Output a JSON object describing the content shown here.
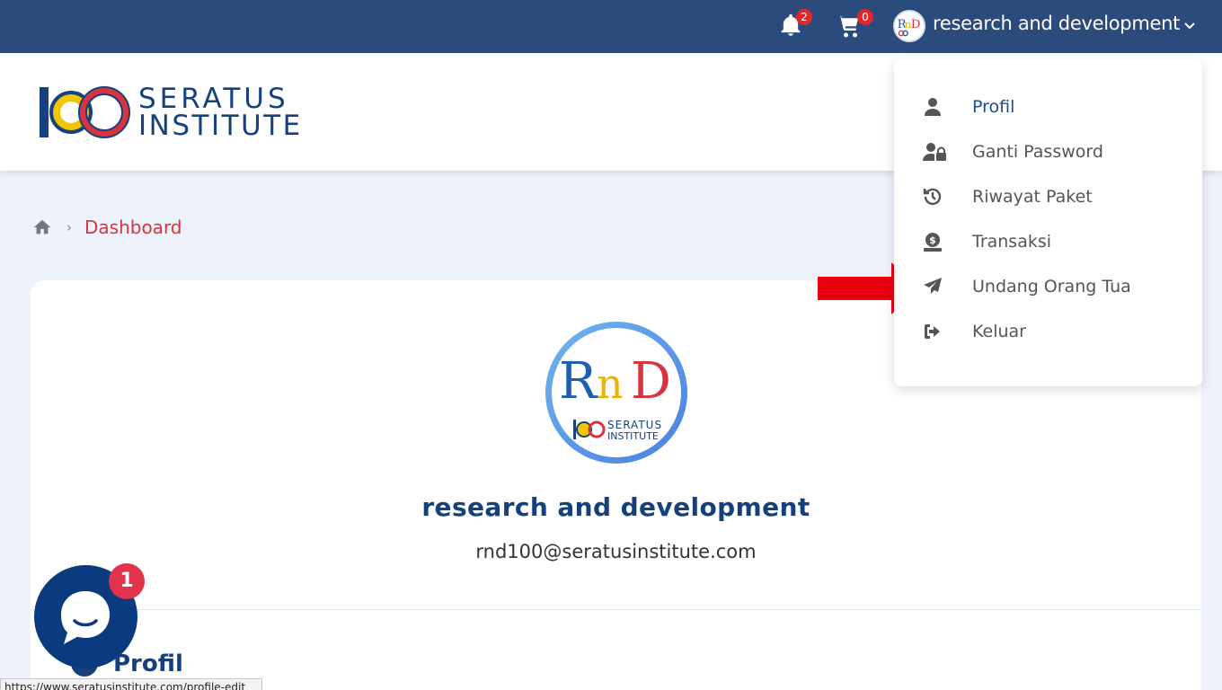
{
  "topbar": {
    "notifications_count": "2",
    "cart_count": "0",
    "user_name": "research and development"
  },
  "brand": {
    "line1": "SERATUS",
    "line2": "INSTITUTE",
    "avatar_text": "RnD"
  },
  "breadcrumb": {
    "current": "Dashboard"
  },
  "profile_card": {
    "name": "research and development",
    "email": "rnd100@seratusinstitute.com",
    "section_title": "Profil"
  },
  "dropdown": {
    "items": [
      {
        "label": "Profil",
        "icon": "user-icon"
      },
      {
        "label": "Ganti Password",
        "icon": "user-lock-icon"
      },
      {
        "label": "Riwayat Paket",
        "icon": "history-icon"
      },
      {
        "label": "Transaksi",
        "icon": "money-bag-icon"
      },
      {
        "label": "Undang Orang Tua",
        "icon": "paper-plane-icon"
      },
      {
        "label": "Keluar",
        "icon": "sign-out-icon"
      }
    ]
  },
  "chat": {
    "badge": "1"
  },
  "status_bar": {
    "url": "https://www.seratusinstitute.com/profile-edit"
  },
  "colors": {
    "topbar": "#2a4b7c",
    "brand_blue": "#15407e",
    "accent_red": "#d8343f",
    "badge_red": "#e8232a"
  }
}
